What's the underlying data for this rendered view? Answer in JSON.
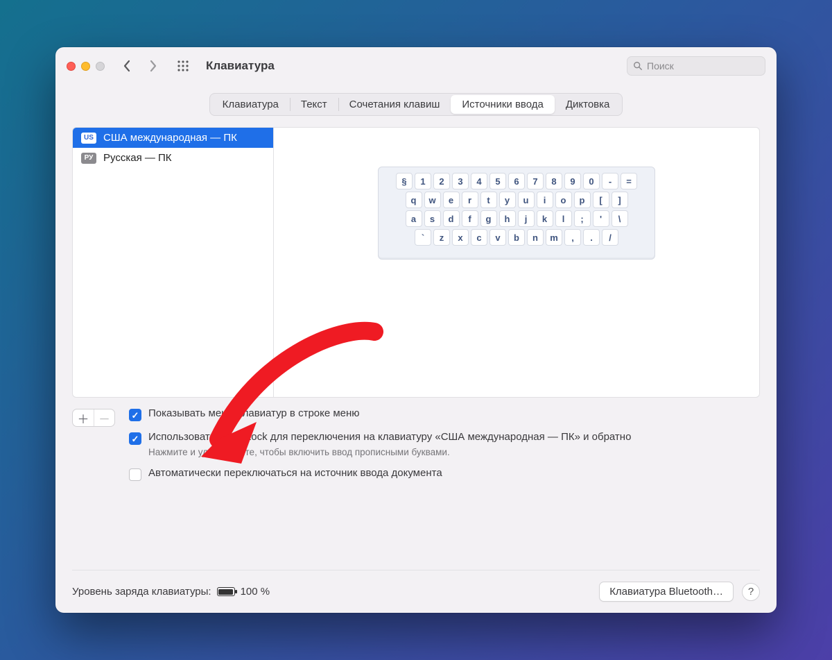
{
  "window": {
    "title": "Клавиатура"
  },
  "search": {
    "placeholder": "Поиск"
  },
  "tabs": [
    {
      "label": "Клавиатура"
    },
    {
      "label": "Текст"
    },
    {
      "label": "Сочетания клавиш"
    },
    {
      "label": "Источники ввода",
      "active": true
    },
    {
      "label": "Диктовка"
    }
  ],
  "sources": [
    {
      "flag": "US",
      "label": "США международная — ПК",
      "selected": true
    },
    {
      "flag": "РУ",
      "label": "Русская — ПК",
      "selected": false
    }
  ],
  "keyboard_rows": [
    [
      "§",
      "1",
      "2",
      "3",
      "4",
      "5",
      "6",
      "7",
      "8",
      "9",
      "0",
      "-",
      "="
    ],
    [
      "q",
      "w",
      "e",
      "r",
      "t",
      "y",
      "u",
      "i",
      "o",
      "p",
      "[",
      "]"
    ],
    [
      "a",
      "s",
      "d",
      "f",
      "g",
      "h",
      "j",
      "k",
      "l",
      ";",
      "'",
      "\\"
    ],
    [
      "`",
      "z",
      "x",
      "c",
      "v",
      "b",
      "n",
      "m",
      ",",
      ".",
      "/"
    ]
  ],
  "options": {
    "show_menu": {
      "checked": true,
      "label": "Показывать меню клавиатур в строке меню"
    },
    "caps_lock": {
      "checked": true,
      "label": "Использовать Caps Lock для переключения на клавиатуру «США международная — ПК» и обратно",
      "hint": "Нажмите и удерживайте, чтобы включить ввод прописными буквами."
    },
    "auto_switch": {
      "checked": false,
      "label": "Автоматически переключаться на источник ввода документа"
    }
  },
  "footer": {
    "battery_label": "Уровень заряда клавиатуры:",
    "battery_value": "100 %",
    "bluetooth_button": "Клавиатура Bluetooth…"
  }
}
